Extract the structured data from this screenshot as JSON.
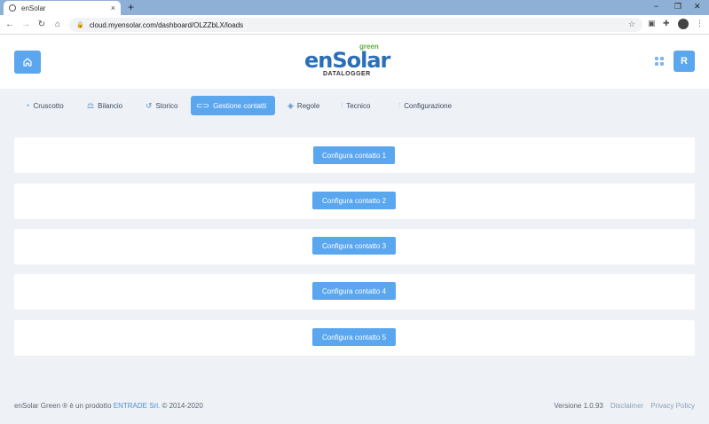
{
  "browser": {
    "tab_title": "enSolar",
    "tab_close": "×",
    "new_tab": "+",
    "url": "cloud.myensolar.com/dashboard/OLZZbLX/loads",
    "window_controls": [
      "−",
      "❐",
      "✕"
    ]
  },
  "header": {
    "logo_text": "enSolar",
    "logo_green": "green",
    "logo_sub": "DATALOGGER",
    "user_initial": "R"
  },
  "nav": {
    "items": [
      {
        "label": "Cruscotto",
        "icon": "gauge-icon"
      },
      {
        "label": "Bilancio",
        "icon": "scale-icon"
      },
      {
        "label": "Storico",
        "icon": "history-icon"
      },
      {
        "label": "Gestione contatti",
        "icon": "toggle-icon",
        "active": true
      },
      {
        "label": "Regole",
        "icon": "layers-icon"
      },
      {
        "label": "Tecnico",
        "icon": "sliders-icon"
      },
      {
        "label": "Configurazione",
        "icon": "sliders-icon"
      }
    ]
  },
  "cards": [
    {
      "button": "Configura contatto 1"
    },
    {
      "button": "Configura contatto 2"
    },
    {
      "button": "Configura contatto 3"
    },
    {
      "button": "Configura contatto 4"
    },
    {
      "button": "Configura contatto 5"
    }
  ],
  "footer": {
    "left_prefix": "enSolar Green ® è un prodotto",
    "left_company": "ENTRADE Srl.",
    "left_suffix": "© 2014-2020",
    "version": "Versione 1.0.93",
    "disclaimer": "Disclaimer",
    "privacy": "Privacy Policy"
  },
  "colors": {
    "accent": "#5aa6ef",
    "background": "#eef2f7",
    "chrome": "#8fb0d6"
  }
}
